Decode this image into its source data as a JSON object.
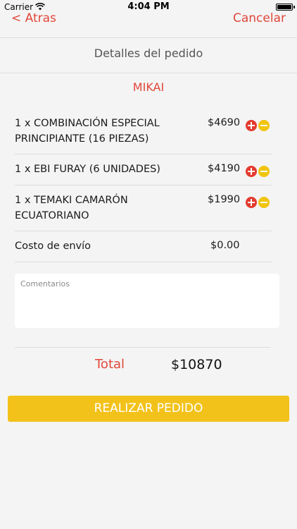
{
  "status_bar": {
    "carrier": "Carrier",
    "time": "4:04 PM"
  },
  "nav": {
    "back_label": "< Atras",
    "cancel_label": "Cancelar"
  },
  "page_title": "Detalles del pedido",
  "restaurant": "MIKAI",
  "items": [
    {
      "name": "1 x COMBINACIÓN ESPECIAL PRINCIPIANTE (16 PIEZAS)",
      "price": "$4690"
    },
    {
      "name": "1 x EBI FURAY (6 UNIDADES)",
      "price": "$4190"
    },
    {
      "name": "1 x TEMAKI CAMARÓN ECUATORIANO",
      "price": "$1990"
    }
  ],
  "shipping": {
    "label": "Costo de envío",
    "price": "$0.00"
  },
  "comments": {
    "placeholder": "Comentarios"
  },
  "total": {
    "label": "Total",
    "value": "$10870"
  },
  "place_order_label": "REALIZAR PEDIDO",
  "colors": {
    "accent": "#e0473a",
    "button": "#f2c21b",
    "plus": "#e43a2f",
    "minus": "#f1c40f"
  }
}
